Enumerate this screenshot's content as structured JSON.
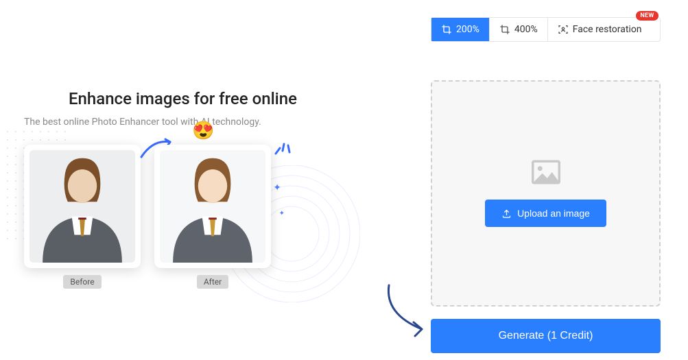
{
  "promo": {
    "title": "Enhance images for free online",
    "subtitle": "The best online Photo Enhancer tool with AI technology.",
    "before_label": "Before",
    "after_label": "After",
    "emoji": "😍"
  },
  "options": {
    "zoom200": "200%",
    "zoom400": "400%",
    "face_restoration": "Face restoration",
    "new_badge": "NEW"
  },
  "upload": {
    "button_label": "Upload an image"
  },
  "generate": {
    "button_label": "Generate (1 Credit)"
  }
}
